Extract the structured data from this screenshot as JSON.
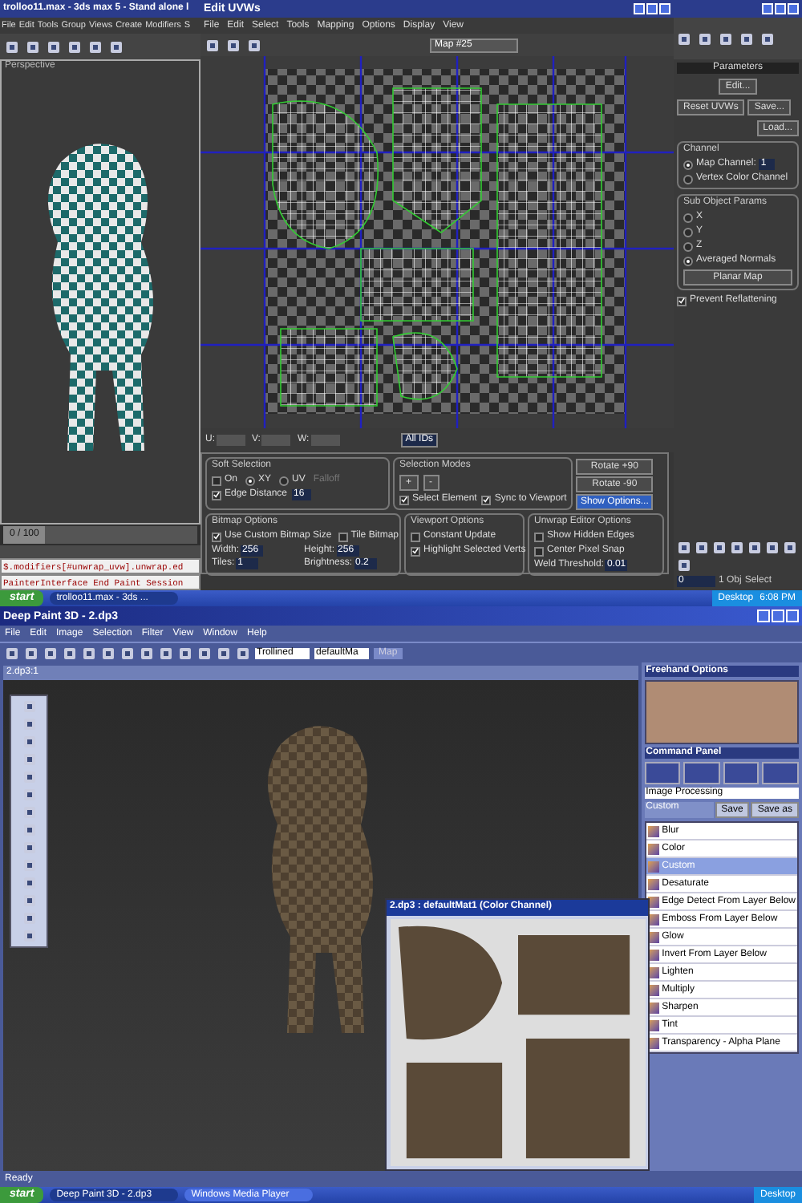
{
  "max_window": {
    "title": "trolloo11.max - 3ds max 5 - Stand alone l",
    "menu": [
      "File",
      "Edit",
      "Tools",
      "Group",
      "Views",
      "Create",
      "Modifiers",
      "S"
    ],
    "viewport_label": "Perspective",
    "time_slider": {
      "label": "0 / 100",
      "level": 0
    },
    "script_lines": [
      "$.modifiers[#unwrap_uvw].unwrap.ed",
      "PainterInterface End Paint Session"
    ],
    "status_texts": [
      "1 Obj",
      "Select"
    ],
    "frame_field": "0"
  },
  "uvw_editor": {
    "title": "Edit UVWs",
    "menu": [
      "File",
      "Edit",
      "Select",
      "Tools",
      "Mapping",
      "Options",
      "Display",
      "View"
    ],
    "map_dropdown": "Map #25",
    "coords": [
      "U:",
      "V:",
      "W:"
    ],
    "id_dropdown": "All IDs",
    "soft_selection": {
      "title": "Soft Selection",
      "options": [
        {
          "label": "On",
          "kind": "checkbox",
          "checked": false
        },
        {
          "label": "XY",
          "kind": "radio",
          "checked": true
        },
        {
          "label": "UV",
          "kind": "radio",
          "checked": false
        }
      ],
      "falloff_label": "Falloff",
      "edge_distance": {
        "label": "Edge Distance",
        "checked": true,
        "value": "16"
      }
    },
    "selection_modes": {
      "title": "Selection Modes",
      "options": [
        {
          "label": "Select Element",
          "checked": true
        },
        {
          "label": "Sync to Viewport",
          "checked": true
        }
      ],
      "buttons": [
        "+",
        "-"
      ]
    },
    "side_buttons": [
      {
        "label": "Rotate +90",
        "selected": false
      },
      {
        "label": "Rotate -90",
        "selected": false
      },
      {
        "label": "Show Options...",
        "selected": true
      }
    ],
    "bitmap_options": {
      "title": "Bitmap Options",
      "options": [
        {
          "label": "Use Custom Bitmap Size",
          "checked": true
        },
        {
          "label": "Tile Bitmap",
          "checked": false
        }
      ],
      "fields": [
        {
          "label": "Width:",
          "value": "256"
        },
        {
          "label": "Height:",
          "value": "256"
        },
        {
          "label": "Tiles:",
          "value": "1"
        },
        {
          "label": "Brightness:",
          "value": "0.2"
        }
      ]
    },
    "viewport_options": {
      "title": "Viewport Options",
      "options": [
        {
          "label": "Constant Update",
          "checked": false
        },
        {
          "label": "Highlight Selected Verts",
          "checked": true
        }
      ]
    },
    "editor_options": {
      "title": "Unwrap Editor Options",
      "options": [
        {
          "label": "Show Hidden Edges",
          "checked": false
        },
        {
          "label": "Center Pixel Snap",
          "checked": false
        }
      ],
      "weld": {
        "label": "Weld Threshold:",
        "value": "0.01"
      }
    }
  },
  "command_panel": {
    "rollout": "Parameters",
    "buttons": [
      "Edit...",
      "Reset UVWs",
      "Save...",
      "Load..."
    ],
    "channel": {
      "title": "Channel",
      "options": [
        {
          "label": "Map Channel:",
          "checked": true
        },
        {
          "label": "Vertex Color Channel",
          "checked": false
        }
      ],
      "value": "1"
    },
    "sub_object": {
      "title": "Sub Object Params",
      "options": [
        {
          "label": "X",
          "checked": false
        },
        {
          "label": "Y",
          "checked": false
        },
        {
          "label": "Z",
          "checked": false
        },
        {
          "label": "Averaged Normals",
          "checked": true
        }
      ],
      "button": "Planar Map"
    },
    "prevent": {
      "label": "Prevent Reflattening",
      "checked": true
    }
  },
  "taskbar_top": {
    "start": "start",
    "tasks": [
      {
        "label": "trolloo11.max - 3ds ...",
        "selected": true
      }
    ],
    "tray": "Desktop",
    "clock": "6:08 PM"
  },
  "deep_paint": {
    "title": "Deep Paint 3D - 2.dp3",
    "menu": [
      "File",
      "Edit",
      "Image",
      "Selection",
      "Filter",
      "View",
      "Window",
      "Help"
    ],
    "object_dropdown": "Trollined",
    "material_dropdown": "defaultMa",
    "map_button": "Map",
    "document_title": "2.dp3:1",
    "texture_window_title": "2.dp3 : defaultMat1 (Color Channel)",
    "freehand_title": "Freehand Options",
    "command_title": "Command Panel",
    "category_dropdown": "Image Processing",
    "preset_dropdown": "Custom",
    "preset_buttons": [
      "Save",
      "Save as"
    ],
    "filters": [
      {
        "label": "Blur",
        "selected": false
      },
      {
        "label": "Color",
        "selected": false
      },
      {
        "label": "Custom",
        "selected": true
      },
      {
        "label": "Desaturate",
        "selected": false
      },
      {
        "label": "Edge Detect From Layer Below",
        "selected": false
      },
      {
        "label": "Emboss From Layer Below",
        "selected": false
      },
      {
        "label": "Glow",
        "selected": false
      },
      {
        "label": "Invert From Layer Below",
        "selected": false
      },
      {
        "label": "Lighten",
        "selected": false
      },
      {
        "label": "Multiply",
        "selected": false
      },
      {
        "label": "Sharpen",
        "selected": false
      },
      {
        "label": "Tint",
        "selected": false
      },
      {
        "label": "Transparency - Alpha Plane",
        "selected": false
      }
    ],
    "status": "Ready"
  },
  "taskbar_bottom": {
    "start": "start",
    "tasks": [
      {
        "label": "Deep Paint 3D - 2.dp3",
        "selected": true
      },
      {
        "label": "Windows Media Player",
        "selected": false
      }
    ],
    "tray": "Desktop"
  }
}
